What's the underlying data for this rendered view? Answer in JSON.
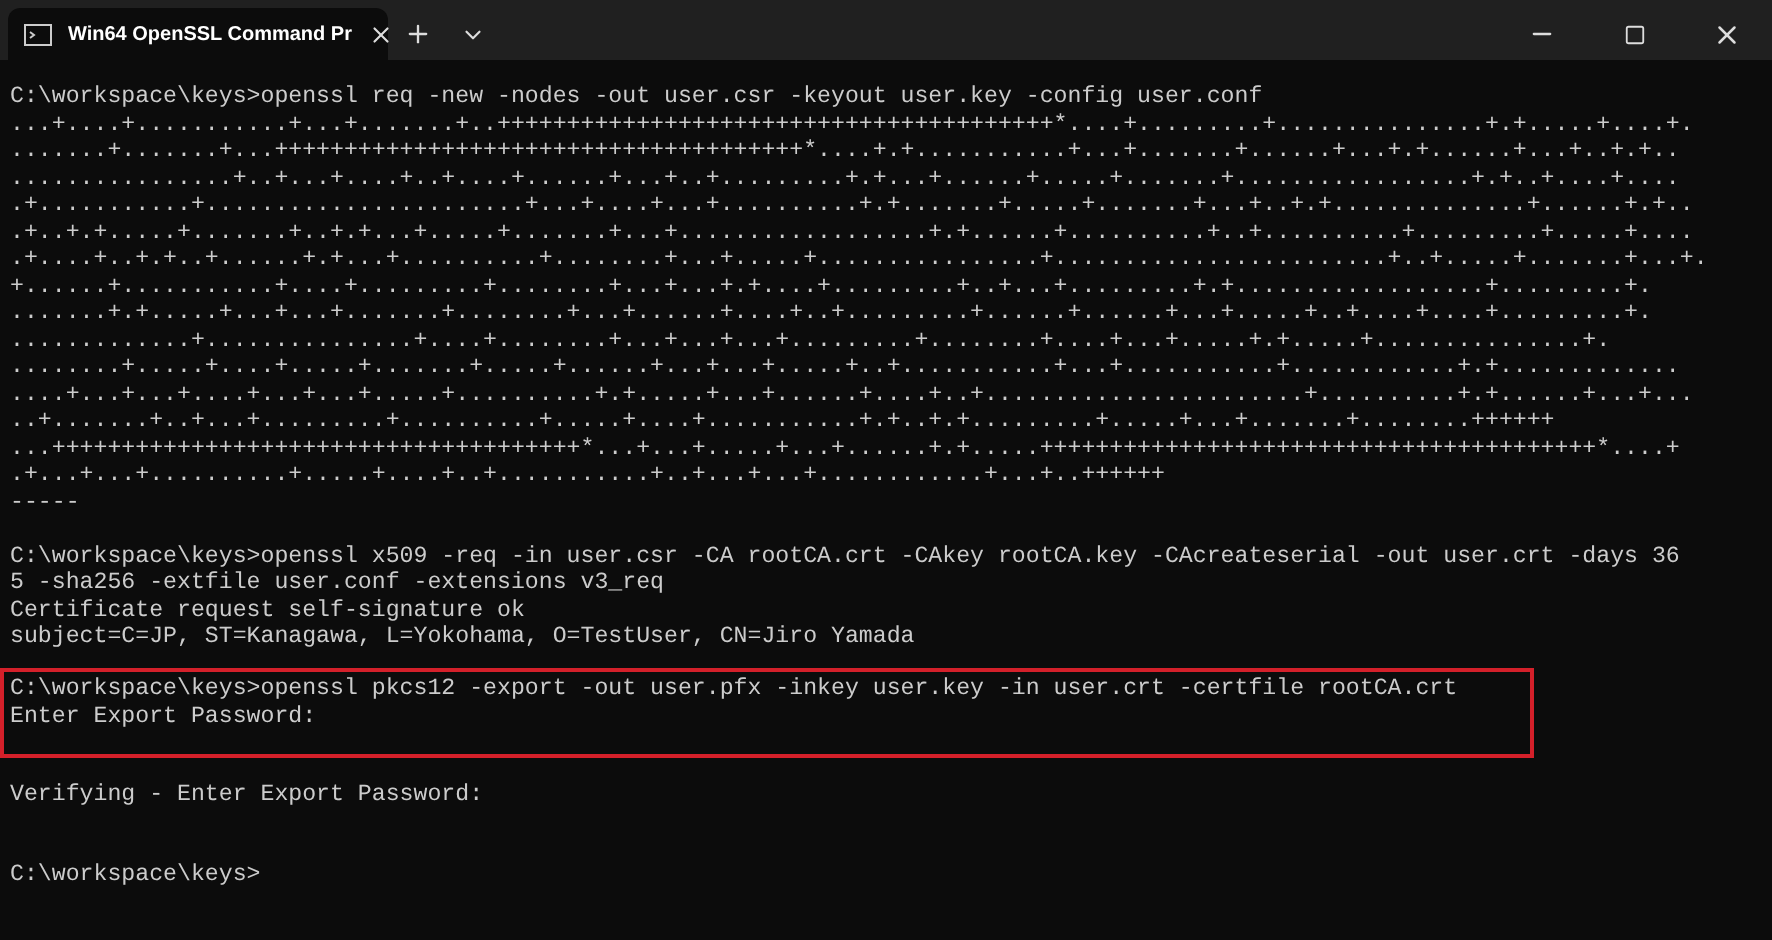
{
  "tab": {
    "title": "Win64 OpenSSL Command Pr",
    "selected": true
  },
  "sections": [
    {
      "kind": "output",
      "highlighted": false,
      "lines": [
        "C:\\workspace\\keys>openssl req -new -nodes -out user.csr -keyout user.key -config user.conf",
        "...+....+...........+...+.......+..++++++++++++++++++++++++++++++++++++++++*....+.........+...............+.+.....+....+.",
        ".......+.......+...++++++++++++++++++++++++++++++++++++++*....+.+...........+...+.......+......+...+.+......+...+..+.+..",
        "................+..+...+....+..+....+......+...+..+.........+.+...+......+.....+.......+.................+.+..+....+....",
        ".+...........+.......................+...+....+...+..........+.+.......+.....+.......+...+..+.+..............+......+.+..",
        ".+..+.+.....+.......+..+.+...+.....+.......+...+..................+.+......+..........+..+..........+.........+.....+....",
        ".+....+..+.+..+......+.+...+..........+........+...+.....+................+........................+..+.....+.......+...+.",
        "+......+...........+....+.........+........+...+...+.+....+.........+..+...+.........+.+..................+.........+.",
        ".......+.+.....+...+...+.......+........+...+......+....+..+.........+......+......+...+.....+..+....+....+.........+.",
        ".............+...............+....+........+...+...+...+.........+........+....+...+.....+.+.....+...............+.",
        "........+.....+....+.....+.......+.....+......+...+...+.....+..+...........+...+...........+............+.+.............",
        "....+...+...+....+...+...+.....+..........+.+.....+...+......+....+..+.......................+..........+.+......+...+...",
        "..+.......+..+...+.........+..........+.....+....+...........+.+..+.+.........+.....+...+.......+........++++++",
        "...++++++++++++++++++++++++++++++++++++++*...+...+.....+...+......+.+.....++++++++++++++++++++++++++++++++++++++++*....+",
        ".+...+...+..........+.....+....+..+...........+..+...+...+............+...+..++++++",
        "-----"
      ]
    },
    {
      "kind": "output",
      "highlighted": false,
      "lines": [
        "C:\\workspace\\keys>openssl x509 -req -in user.csr -CA rootCA.crt -CAkey rootCA.key -CAcreateserial -out user.crt -days 36",
        "5 -sha256 -extfile user.conf -extensions v3_req",
        "Certificate request self-signature ok",
        "subject=C=JP, ST=Kanagawa, L=Yokohama, O=TestUser, CN=Jiro Yamada"
      ]
    },
    {
      "kind": "output",
      "highlighted": true,
      "lines": [
        "C:\\workspace\\keys>openssl pkcs12 -export -out user.pfx -inkey user.key -in user.crt -certfile rootCA.crt",
        "Enter Export Password:"
      ]
    },
    {
      "kind": "output",
      "highlighted": false,
      "lines": [
        "Verifying - Enter Export Password:"
      ]
    },
    {
      "kind": "prompt",
      "highlighted": false,
      "lines": [
        "C:\\workspace\\keys>"
      ]
    }
  ]
}
